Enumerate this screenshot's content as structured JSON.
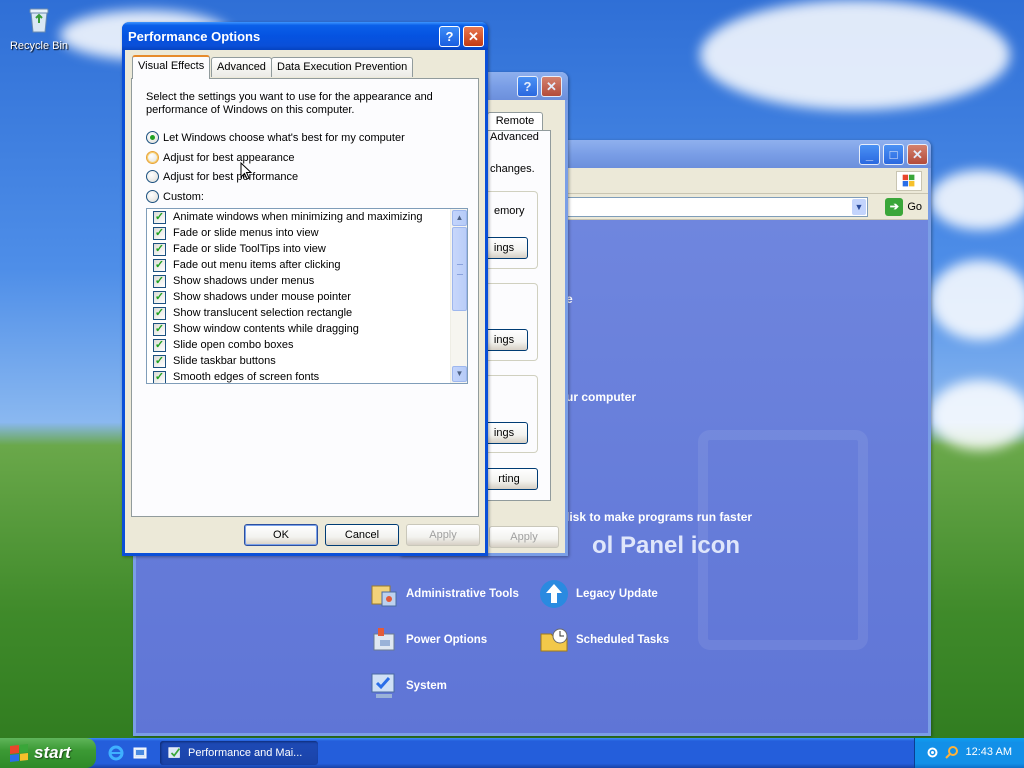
{
  "desktop": {
    "recycle_bin_label": "Recycle Bin"
  },
  "control_panel": {
    "go_label": "Go",
    "fragment_lines": [
      "e",
      "ur computer",
      "lisk to make programs run faster"
    ],
    "heading_fragment": "ol Panel icon",
    "tasks": [
      {
        "label": "Administrative Tools",
        "icon": "admin-tools-icon"
      },
      {
        "label": "Legacy Update",
        "icon": "legacy-update-icon"
      },
      {
        "label": "Power Options",
        "icon": "power-options-icon"
      },
      {
        "label": "Scheduled Tasks",
        "icon": "scheduled-tasks-icon"
      },
      {
        "label": "System",
        "icon": "system-icon"
      }
    ]
  },
  "system_properties": {
    "tab_remote": "Remote",
    "text_advanced": "Advanced",
    "text_changes": "changes.",
    "text_memory": "emory",
    "btn_settings_1": "ings",
    "btn_settings_2": "ings",
    "btn_settings_3": "ings",
    "btn_setting_4": "rting",
    "apply_label": "Apply"
  },
  "performance_options": {
    "title": "Performance Options",
    "tabs": [
      "Visual Effects",
      "Advanced",
      "Data Execution Prevention"
    ],
    "active_tab": "Visual Effects",
    "description": "Select the settings you want to use for the appearance and performance of Windows on this computer.",
    "radios": [
      {
        "label": "Let Windows choose what's best for my computer",
        "selected": true
      },
      {
        "label": "Adjust for best appearance",
        "selected": false
      },
      {
        "label": "Adjust for best performance",
        "selected": false
      },
      {
        "label": "Custom:",
        "selected": false
      }
    ],
    "effects": [
      {
        "label": "Animate windows when minimizing and maximizing",
        "checked": true
      },
      {
        "label": "Fade or slide menus into view",
        "checked": true
      },
      {
        "label": "Fade or slide ToolTips into view",
        "checked": true
      },
      {
        "label": "Fade out menu items after clicking",
        "checked": true
      },
      {
        "label": "Show shadows under menus",
        "checked": true
      },
      {
        "label": "Show shadows under mouse pointer",
        "checked": true
      },
      {
        "label": "Show translucent selection rectangle",
        "checked": true
      },
      {
        "label": "Show window contents while dragging",
        "checked": true
      },
      {
        "label": "Slide open combo boxes",
        "checked": true
      },
      {
        "label": "Slide taskbar buttons",
        "checked": true
      },
      {
        "label": "Smooth edges of screen fonts",
        "checked": true
      }
    ],
    "ok_label": "OK",
    "cancel_label": "Cancel",
    "apply_label": "Apply",
    "help_button": "?",
    "close_button": "✕"
  },
  "taskbar": {
    "start_label": "start",
    "task_button": "Performance and Mai...",
    "clock": "12:43 AM"
  },
  "colors": {
    "title_active": "#0a5fe9",
    "control_panel_bg": "#6f86de",
    "checkmark": "#21a121"
  }
}
